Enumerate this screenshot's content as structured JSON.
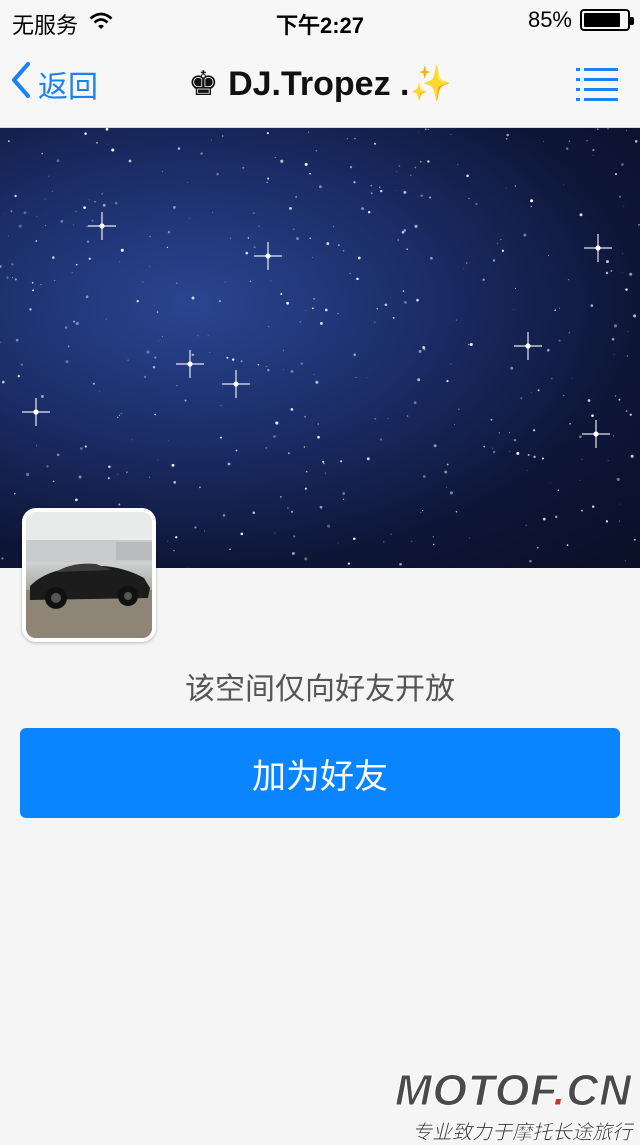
{
  "status_bar": {
    "carrier": "无服务",
    "time": "下午2:27",
    "battery_percent": "85%",
    "battery_level": 0.85,
    "icons": [
      "wifi-icon",
      "battery-icon"
    ]
  },
  "nav": {
    "back_label": "返回",
    "title": "♚ DJ.Tropez .✨",
    "icons": [
      "chevron-left-icon",
      "menu-list-icon"
    ]
  },
  "profile": {
    "cover_description_icon": "starfield-cover",
    "avatar_icon": "car-avatar"
  },
  "main": {
    "notice": "该空间仅向好友开放",
    "add_friend_label": "加为好友"
  },
  "watermark": {
    "logo_prefix": "MOTOF",
    "logo_dot": ".",
    "logo_suffix": "CN",
    "tagline": "专业致力于摩托长途旅行"
  },
  "colors": {
    "accent": "#0a84ff",
    "link": "#1a82f5",
    "background": "#f5f5f5"
  }
}
